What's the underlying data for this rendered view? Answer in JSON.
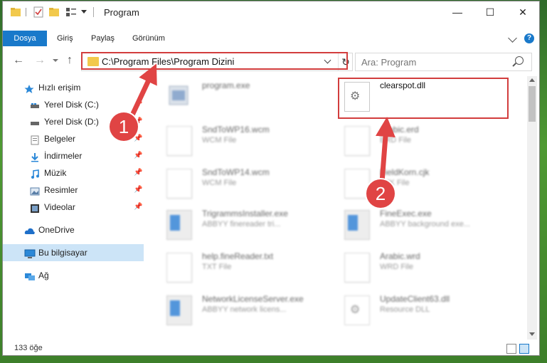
{
  "window": {
    "title": "Program"
  },
  "window_controls": {
    "minimize": "—",
    "maximize": "☐",
    "close": "✕"
  },
  "ribbon": {
    "tabs": [
      "Dosya",
      "Giriş",
      "Paylaş",
      "Görünüm"
    ]
  },
  "navbar": {
    "address": "C:\\Program Files\\Program Dizini",
    "refresh": "↻",
    "search_placeholder": "Ara: Program"
  },
  "sidebar": {
    "items": [
      {
        "label": "Hızlı erişim",
        "icon": "star-icon"
      },
      {
        "label": "Yerel Disk (C:)",
        "icon": "drive-icon"
      },
      {
        "label": "Yerel Disk (D:)",
        "icon": "drive-icon"
      },
      {
        "label": "Belgeler",
        "icon": "documents-icon"
      },
      {
        "label": "İndirmeler",
        "icon": "download-icon"
      },
      {
        "label": "Müzik",
        "icon": "music-icon"
      },
      {
        "label": "Resimler",
        "icon": "pictures-icon"
      },
      {
        "label": "Videolar",
        "icon": "video-icon"
      },
      {
        "label": "OneDrive",
        "icon": "cloud-icon"
      },
      {
        "label": "Bu bilgisayar",
        "icon": "computer-icon"
      },
      {
        "label": "Ağ",
        "icon": "network-icon"
      }
    ]
  },
  "files": [
    {
      "name": "program.exe",
      "desc": "",
      "type": "app"
    },
    {
      "name": "clearspot.dll",
      "desc": "",
      "type": "dll"
    },
    {
      "name": "SndToWP16.wcm",
      "desc": "WCM File",
      "type": "doc"
    },
    {
      "name": "Arabic.erd",
      "desc": "ERD File",
      "type": "doc"
    },
    {
      "name": "SndToWP14.wcm",
      "desc": "WCM File",
      "type": "doc"
    },
    {
      "name": "FieldKorn.cjk",
      "desc": "CJK File",
      "type": "doc"
    },
    {
      "name": "TrigrammsInstaller.exe",
      "desc": "ABBYY finereader tri...",
      "type": "app"
    },
    {
      "name": "FineExec.exe",
      "desc": "ABBYY background exe...",
      "type": "app"
    },
    {
      "name": "help.fineReader.txt",
      "desc": "TXT File",
      "type": "doc"
    },
    {
      "name": "Arabic.wrd",
      "desc": "WRD File",
      "type": "doc"
    },
    {
      "name": "NetworkLicenseServer.exe",
      "desc": "ABBYY network licens...",
      "type": "app"
    },
    {
      "name": "UpdateClient63.dll",
      "desc": "Resource DLL",
      "type": "dll"
    }
  ],
  "status": {
    "count": "133 öğe"
  },
  "callouts": [
    "1",
    "2"
  ],
  "colors": {
    "accent": "#1979ca",
    "highlight": "#d23d3d",
    "callout": "#e04444"
  }
}
